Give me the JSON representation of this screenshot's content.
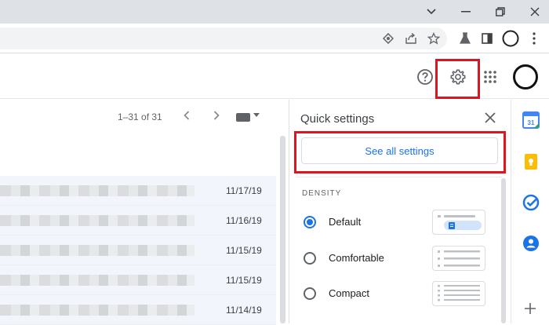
{
  "window_controls": {
    "chevron_label": "⌄",
    "minimize_label": "—",
    "restore_label": "⧉",
    "close_label": "✕"
  },
  "gmail": {
    "pagination": "1–31 of 31",
    "mail_rows": [
      {
        "date": "11/17/19"
      },
      {
        "date": "11/16/19"
      },
      {
        "date": "11/15/19"
      },
      {
        "date": "11/15/19"
      },
      {
        "date": "11/14/19"
      }
    ]
  },
  "quick_settings": {
    "title": "Quick settings",
    "close_label": "✕",
    "see_all_label": "See all settings",
    "density_heading": "DENSITY",
    "density_options": [
      {
        "label": "Default",
        "selected": true
      },
      {
        "label": "Comfortable",
        "selected": false
      },
      {
        "label": "Compact",
        "selected": false
      }
    ]
  },
  "colors": {
    "highlight": "#e0141e",
    "accent_blue": "#1a73e8",
    "calendar_blue": "#4285f4",
    "keep_yellow": "#fbbc04"
  },
  "icons": [
    "help-icon",
    "gear-icon",
    "apps-grid-icon",
    "account-avatar",
    "calendar-icon",
    "keep-icon",
    "tasks-icon",
    "contacts-icon",
    "add-icon"
  ]
}
